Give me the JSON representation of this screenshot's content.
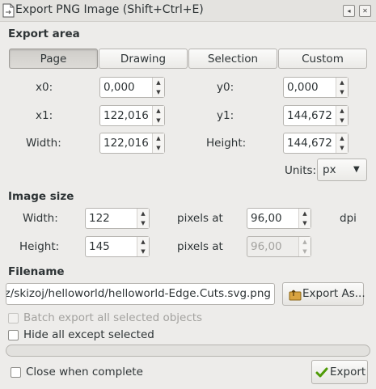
{
  "window": {
    "title": "Export PNG Image (Shift+Ctrl+E)",
    "icons": [
      "document-export-icon",
      "restore-icon",
      "close-icon"
    ]
  },
  "export_area": {
    "heading": "Export area",
    "tabs": [
      {
        "label": "Page",
        "active": true
      },
      {
        "label": "Drawing",
        "active": false
      },
      {
        "label": "Selection",
        "active": false
      },
      {
        "label": "Custom",
        "active": false
      }
    ],
    "x0": {
      "label": "x0:",
      "value": "0,000"
    },
    "y0": {
      "label": "y0:",
      "value": "0,000"
    },
    "x1": {
      "label": "x1:",
      "value": "122,016"
    },
    "y1": {
      "label": "y1:",
      "value": "144,672"
    },
    "width": {
      "label": "Width:",
      "value": "122,016"
    },
    "height": {
      "label": "Height:",
      "value": "144,672"
    },
    "units": {
      "label": "Units:",
      "value": "px"
    }
  },
  "image_size": {
    "heading": "Image size",
    "width": {
      "label": "Width:",
      "value": "122"
    },
    "height": {
      "label": "Height:",
      "value": "145"
    },
    "pixels_at_label": "pixels at",
    "dpi_x": "96,00",
    "dpi_y": "96,00",
    "dpi_label": "dpi"
  },
  "filename": {
    "heading": "Filename",
    "value": "ez/skizoj/helloworld/helloworld-Edge.Cuts.svg.png",
    "export_as_label": "Export As..."
  },
  "options": {
    "batch_export_label": "Batch export all selected objects",
    "hide_all_label": "Hide all except selected",
    "close_when_complete_label": "Close when complete"
  },
  "progress": 0,
  "export_label": "Export",
  "colors": {
    "background": "#edecea",
    "export_check": "#4e9a06",
    "export_as_icon": "#d9a441"
  }
}
